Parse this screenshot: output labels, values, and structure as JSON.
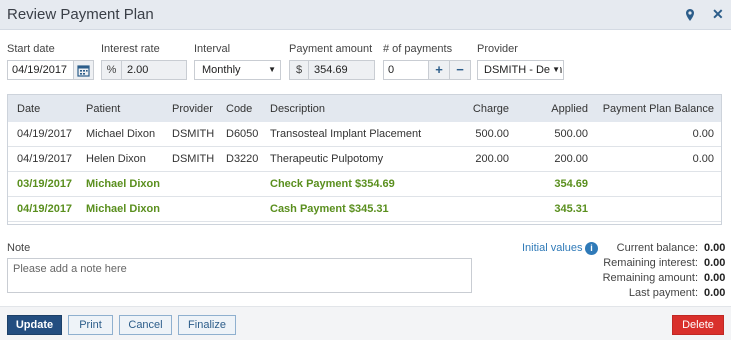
{
  "window": {
    "title": "Review Payment Plan"
  },
  "form": {
    "start_date_label": "Start date",
    "start_date": "04/19/2017",
    "interest_rate_label": "Interest rate",
    "interest_symbol": "%",
    "interest_rate": "2.00",
    "interval_label": "Interval",
    "interval": "Monthly",
    "payment_amount_label": "Payment amount",
    "currency_symbol": "$",
    "payment_amount": "354.69",
    "num_payments_label": "# of payments",
    "num_payments": "0",
    "plus": "+",
    "minus": "−",
    "provider_label": "Provider",
    "provider": "DSMITH - Denn"
  },
  "table": {
    "headers": {
      "date": "Date",
      "patient": "Patient",
      "provider": "Provider",
      "code": "Code",
      "description": "Description",
      "charge": "Charge",
      "applied": "Applied",
      "balance": "Payment Plan Balance"
    },
    "rows": [
      {
        "date": "04/19/2017",
        "patient": "Michael Dixon",
        "provider": "DSMITH",
        "code": "D6050",
        "description": "Transosteal Implant Placement",
        "charge": "500.00",
        "applied": "500.00",
        "balance": "0.00"
      },
      {
        "date": "04/19/2017",
        "patient": "Helen Dixon",
        "provider": "DSMITH",
        "code": "D3220",
        "description": "Therapeutic Pulpotomy",
        "charge": "200.00",
        "applied": "200.00",
        "balance": "0.00"
      },
      {
        "date": "03/19/2017",
        "patient": "Michael Dixon",
        "provider": "",
        "code": "",
        "description": "Check Payment $354.69",
        "charge": "",
        "applied": "354.69",
        "balance": ""
      },
      {
        "date": "04/19/2017",
        "patient": "Michael Dixon",
        "provider": "",
        "code": "",
        "description": "Cash Payment $345.31",
        "charge": "",
        "applied": "345.31",
        "balance": ""
      }
    ]
  },
  "note": {
    "label": "Note",
    "placeholder": "Please add a note here"
  },
  "summary": {
    "initial_values": "Initial values",
    "info_icon": "i",
    "current_balance_label": "Current balance:",
    "current_balance": "0.00",
    "remaining_interest_label": "Remaining interest:",
    "remaining_interest": "0.00",
    "remaining_amount_label": "Remaining amount:",
    "remaining_amount": "0.00",
    "last_payment_label": "Last payment:",
    "last_payment": "0.00"
  },
  "buttons": {
    "update": "Update",
    "print": "Print",
    "cancel": "Cancel",
    "finalize": "Finalize",
    "delete": "Delete"
  },
  "colors": {
    "accent": "#244e80",
    "payment_green": "#5a8f1e",
    "danger": "#d9302c",
    "header_bg": "#e6eaf0"
  },
  "icons": {
    "calendar": "calendar-icon",
    "pin": "map-pin-icon",
    "close": "close-icon",
    "dropdown": "chevron-down-icon",
    "info": "info-icon"
  }
}
